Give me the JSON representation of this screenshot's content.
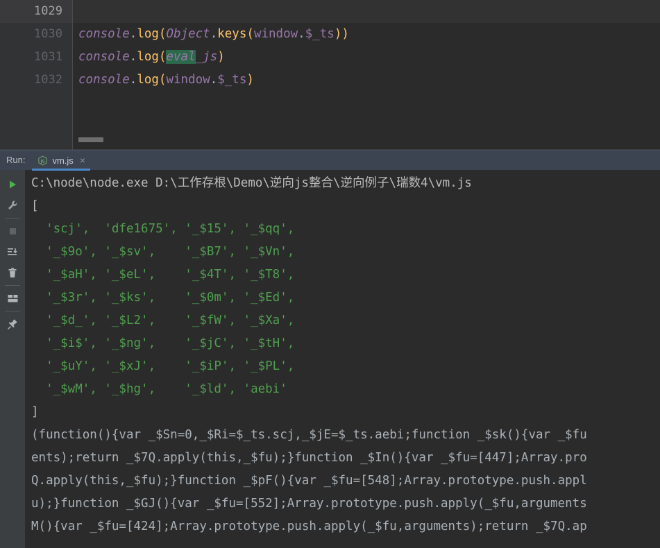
{
  "editor": {
    "lines": [
      {
        "number": "1029",
        "current": true,
        "text": ""
      },
      {
        "number": "1030",
        "current": false,
        "text": "console.log(Object.keys(window.$_ts))"
      },
      {
        "number": "1031",
        "current": false,
        "text": "console.log(eval_js)"
      },
      {
        "number": "1032",
        "current": false,
        "text": "console.log(window.$_ts)"
      }
    ],
    "selection_text": "eval",
    "selection_color": "#2d6a4b",
    "gutter_bg": "#313335",
    "editor_bg": "#2b2b2b"
  },
  "run_window": {
    "label": "Run:",
    "tab": {
      "name": "vm.js",
      "icon": "javascript-file-icon",
      "close": "×",
      "active_underline_color": "#4a88c7"
    },
    "header_bg": "#3c4452",
    "toolbar": [
      {
        "name": "rerun-button",
        "icon": "play-icon",
        "tooltip": "Rerun"
      },
      {
        "name": "settings-button",
        "icon": "wrench-icon",
        "tooltip": "Settings"
      },
      {
        "name": "stop-button",
        "icon": "stop-square-icon",
        "tooltip": "Stop"
      },
      {
        "name": "scroll-to-end-button",
        "icon": "scroll-to-end-icon",
        "tooltip": "Scroll to End"
      },
      {
        "name": "clear-all-button",
        "icon": "trash-icon",
        "tooltip": "Clear All"
      },
      {
        "name": "layout-button",
        "icon": "layout-icon",
        "tooltip": "Layout"
      },
      {
        "name": "pin-tab-button",
        "icon": "pin-icon",
        "tooltip": "Pin Tab"
      }
    ]
  },
  "console": {
    "lines": [
      {
        "style": "info",
        "text": "C:\\node\\node.exe D:\\工作存根\\Demo\\逆向js整合\\逆向例子\\瑞数4\\vm.js"
      },
      {
        "style": "info",
        "text": "["
      },
      {
        "style": "green",
        "text": "  'scj',  'dfe1675', '_$15', '_$qq',"
      },
      {
        "style": "green",
        "text": "  '_$9o', '_$sv',    '_$B7', '_$Vn',"
      },
      {
        "style": "green",
        "text": "  '_$aH', '_$eL',    '_$4T', '_$T8',"
      },
      {
        "style": "green",
        "text": "  '_$3r', '_$ks',    '_$0m', '_$Ed',"
      },
      {
        "style": "green",
        "text": "  '_$d_', '_$L2',    '_$fW', '_$Xa',"
      },
      {
        "style": "green",
        "text": "  '_$i$', '_$ng',    '_$jC', '_$tH',"
      },
      {
        "style": "green",
        "text": "  '_$uY', '_$xJ',    '_$iP', '_$PL',"
      },
      {
        "style": "green",
        "text": "  '_$wM', '_$hg',    '_$ld', 'aebi'"
      },
      {
        "style": "info",
        "text": "]"
      },
      {
        "style": "dim",
        "text": "(function(){var _$Sn=0,_$Ri=$_ts.scj,_$jE=$_ts.aebi;function _$sk(){var _$fu"
      },
      {
        "style": "dim",
        "text": "ents);return _$7Q.apply(this,_$fu);}function _$In(){var _$fu=[447];Array.pro"
      },
      {
        "style": "dim",
        "text": "Q.apply(this,_$fu);}function _$pF(){var _$fu=[548];Array.prototype.push.appl"
      },
      {
        "style": "dim",
        "text": "u);}function _$GJ(){var _$fu=[552];Array.prototype.push.apply(_$fu,arguments"
      },
      {
        "style": "dim",
        "text": "M(){var _$fu=[424];Array.prototype.push.apply(_$fu,arguments);return _$7Q.ap"
      }
    ],
    "colors": {
      "background": "#2b2b2b",
      "string_green": "#4f9e4f",
      "text_gray": "#bbbbbb"
    }
  }
}
